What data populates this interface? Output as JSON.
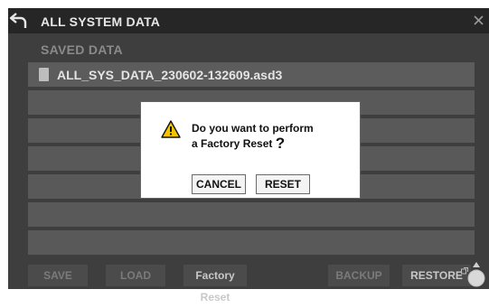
{
  "window": {
    "title": "ALL SYSTEM DATA"
  },
  "section": {
    "label": "SAVED DATA"
  },
  "files": [
    {
      "name": "ALL_SYS_DATA_230602-132609.asd3"
    }
  ],
  "toolbar": {
    "save": "SAVE",
    "load": "LOAD",
    "factory_reset": "Factory Reset",
    "backup": "BACKUP",
    "restore": "RESTORE"
  },
  "dialog": {
    "line1": "Do you want to perform",
    "line2": "a Factory Reset",
    "question_mark": "?",
    "cancel": "CANCEL",
    "reset": "RESET"
  },
  "icons": {
    "back": "back-arrow-icon",
    "close": "close-icon",
    "file": "file-icon",
    "warning": "warning-icon",
    "external": "external-link-icon"
  },
  "colors": {
    "panel_bg": "#3e3e3e",
    "titlebar_bg": "#262626",
    "row_bg": "#595959",
    "warning_yellow": "#f5c400"
  }
}
